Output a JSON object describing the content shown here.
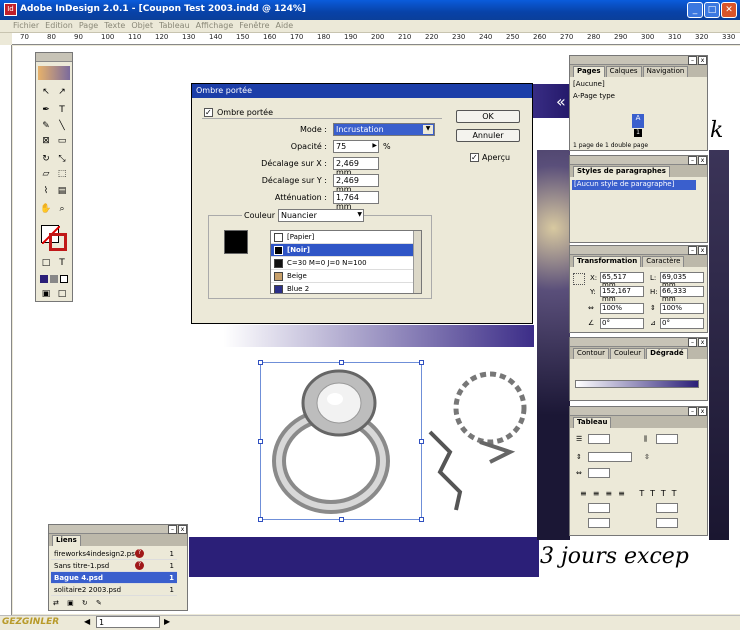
{
  "window": {
    "title": "Adobe InDesign 2.0.1 - [Coupon Test 2003.indd @ 124%]",
    "app_icon": "Id"
  },
  "menu": [
    "Fichier",
    "Edition",
    "Page",
    "Texte",
    "Objet",
    "Tableau",
    "Affichage",
    "Fenêtre",
    "Aide"
  ],
  "ruler": {
    "ticks": [
      "70",
      "80",
      "90",
      "100",
      "110",
      "120",
      "130",
      "140",
      "150",
      "160",
      "170",
      "180",
      "190",
      "200",
      "210",
      "220",
      "230",
      "240",
      "250",
      "260",
      "270",
      "280",
      "290",
      "300",
      "310",
      "320",
      "330"
    ]
  },
  "dialog": {
    "title": "Ombre portée",
    "checkbox_label": "Ombre portée",
    "mode_label": "Mode :",
    "mode_value": "Incrustation",
    "opacity_label": "Opacité :",
    "opacity_value": "75",
    "opacity_unit": "%",
    "offset_x_label": "Décalage sur X :",
    "offset_x_value": "2,469 mm",
    "offset_y_label": "Décalage sur Y :",
    "offset_y_value": "2,469 mm",
    "blur_label": "Atténuation :",
    "blur_value": "1,764 mm",
    "color_label": "Couleur :",
    "color_value": "Nuancier",
    "swatches": [
      "[Papier]",
      "[Noir]",
      "C=30 M=0 J=0 N=100",
      "Beige",
      "Blue 2"
    ],
    "ok_label": "OK",
    "cancel_label": "Annuler",
    "preview_label": "Aperçu"
  },
  "pages_panel": {
    "tabs": [
      "Pages",
      "Calques",
      "Navigation"
    ],
    "items": [
      "[Aucune]",
      "A-Page type"
    ],
    "page_letter": "A",
    "page_number": "1",
    "footer": "1 page de 1 double page"
  },
  "styles_panel": {
    "title": "Styles de paragraphes",
    "item": "[Aucun style de paragraphe]"
  },
  "transform_panel": {
    "tabs": [
      "Transformation",
      "Caractère"
    ],
    "x_label": "X:",
    "x_value": "65,517 mm",
    "y_label": "Y:",
    "y_value": "152,167 mm",
    "w_label": "L:",
    "w_value": "69,035 mm",
    "h_label": "H:",
    "h_value": "66,333 mm",
    "scale_x": "100%",
    "scale_y": "100%",
    "rotate": "0°",
    "shear": "0°"
  },
  "gradient_panel": {
    "tabs": [
      "Contour",
      "Couleur",
      "Dégradé"
    ]
  },
  "table_panel": {
    "title": "Tableau"
  },
  "links_panel": {
    "title": "Liens",
    "items": [
      {
        "name": "fireworks4indesign2.psd",
        "page": "1",
        "warn": true
      },
      {
        "name": "Sans titre-1.psd",
        "page": "1",
        "warn": true
      },
      {
        "name": "Bague 4.psd",
        "page": "1",
        "warn": false
      },
      {
        "name": "solitaire2 2003.psd",
        "page": "1",
        "warn": false
      }
    ]
  },
  "document": {
    "headline": "3 jours excep",
    "side_letter": "k",
    "corner_mark": "«"
  },
  "status": {
    "page_field": "1",
    "watermark": "GEZGINLER"
  }
}
